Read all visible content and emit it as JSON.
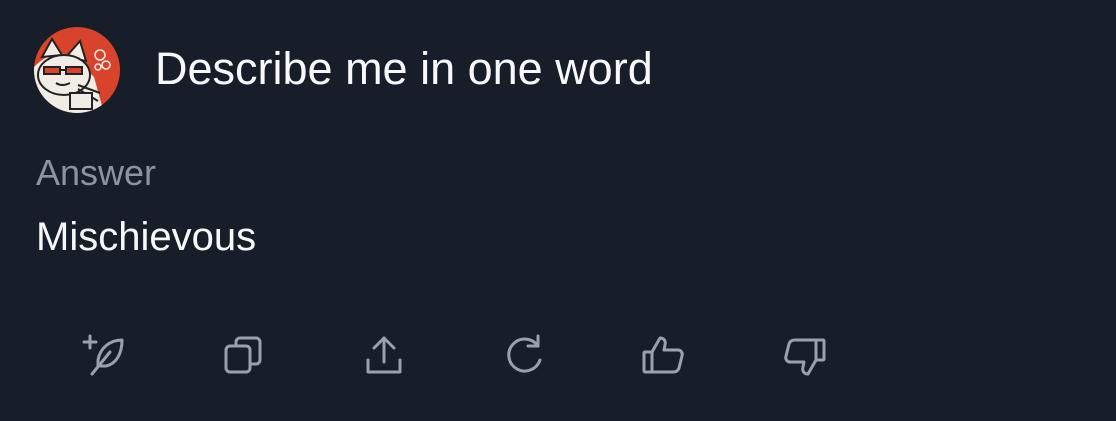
{
  "message": {
    "avatar_icon": "cat-avatar-icon",
    "prompt": "Describe me in one word"
  },
  "answer": {
    "label": "Answer",
    "text": "Mischievous"
  },
  "actions": [
    {
      "icon": "feather-plus-icon"
    },
    {
      "icon": "copy-icon"
    },
    {
      "icon": "share-icon"
    },
    {
      "icon": "regenerate-icon"
    },
    {
      "icon": "thumbs-up-icon"
    },
    {
      "icon": "thumbs-down-icon"
    }
  ],
  "colors": {
    "background": "#181e29",
    "text": "#f7f8fa",
    "muted": "#8c93a1",
    "icon": "#9aa1ad",
    "avatar_red": "#d9432b"
  }
}
